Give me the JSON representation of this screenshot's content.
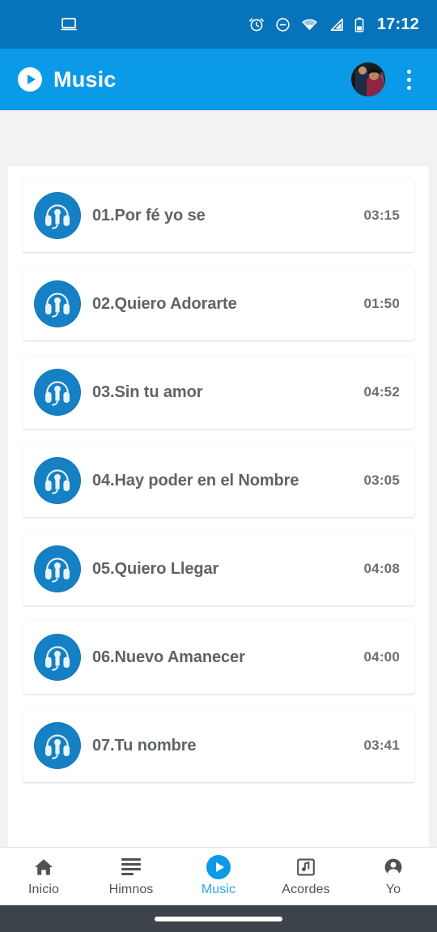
{
  "colors": {
    "status_bar": "#0673ba",
    "app_bar": "#0b9ae8",
    "accent": "#0b9ae8",
    "active_tab": "#27a9e8",
    "track_icon_circle": "#1680c4",
    "page_background": "#f2f2f2",
    "system_nav": "#3c434b",
    "title_text": "#5e6366"
  },
  "status_bar": {
    "cast_icon": "laptop-screen-icon",
    "alarm_icon": "alarm-clock-icon",
    "dnd_icon": "do-not-disturb-icon",
    "wifi_icon": "wifi-icon",
    "signal_icon": "cell-signal-icon",
    "battery_icon": "battery-icon",
    "clock": "17:12"
  },
  "app_bar": {
    "brand_icon": "play-circle-icon",
    "title": "Music",
    "avatar_icon": "user-avatar-photo",
    "overflow_icon": "more-vertical-icon"
  },
  "tracks": [
    {
      "title": "01.Por fé yo se",
      "duration": "03:15",
      "icon": "headphones-icon"
    },
    {
      "title": "02.Quiero Adorarte",
      "duration": "01:50",
      "icon": "headphones-icon"
    },
    {
      "title": "03.Sin tu amor",
      "duration": "04:52",
      "icon": "headphones-icon"
    },
    {
      "title": "04.Hay poder en el Nombre",
      "duration": "03:05",
      "icon": "headphones-icon"
    },
    {
      "title": "05.Quiero Llegar",
      "duration": "04:08",
      "icon": "headphones-icon"
    },
    {
      "title": "06.Nuevo Amanecer",
      "duration": "04:00",
      "icon": "headphones-icon"
    },
    {
      "title": "07.Tu nombre",
      "duration": "03:41",
      "icon": "headphones-icon"
    }
  ],
  "bottom_nav": {
    "active_index": 2,
    "items": [
      {
        "label": "Inicio",
        "icon": "home-icon"
      },
      {
        "label": "Himnos",
        "icon": "list-lines-icon"
      },
      {
        "label": "Music",
        "icon": "play-circle-icon"
      },
      {
        "label": "Acordes",
        "icon": "music-note-box-icon"
      },
      {
        "label": "Yo",
        "icon": "account-circle-icon"
      }
    ]
  },
  "system_nav": {
    "home_indicator": "home-gesture-pill"
  }
}
